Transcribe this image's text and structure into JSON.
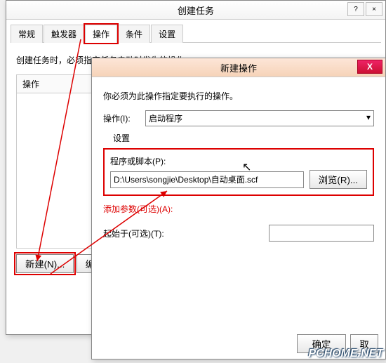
{
  "main": {
    "title": "创建任务",
    "tabs": [
      "常规",
      "触发器",
      "操作",
      "条件",
      "设置"
    ],
    "hint": "创建任务时，必须指定任务启动时发生的操作。",
    "col": "操作",
    "new": "新建(N)...",
    "edit": "编"
  },
  "dlg": {
    "title": "新建操作",
    "hint": "你必须为此操作指定要执行的操作。",
    "action_lbl": "操作(I):",
    "action_val": "启动程序",
    "settings": "设置",
    "prog_lbl": "程序或脚本(P):",
    "path": "D:\\Users\\songjie\\Desktop\\自动桌面.scf",
    "browse": "浏览(R)...",
    "args_lbl": "添加参数(可选)(A):",
    "start_lbl": "起始于(可选)(T):",
    "ok": "确定",
    "cancel": "取"
  },
  "wm": "PCHOME.NET"
}
